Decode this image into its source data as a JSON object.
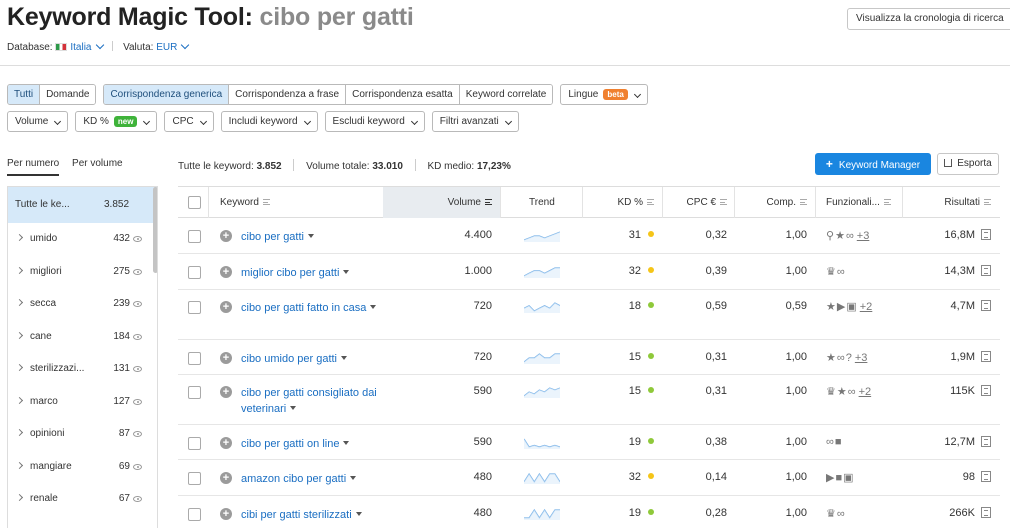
{
  "header": {
    "title": "Keyword Magic Tool:",
    "query": "cibo per gatti",
    "history_button": "Visualizza la cronologia di ricerca",
    "database_label": "Database:",
    "database_value": "Italia",
    "currency_label": "Valuta:",
    "currency_value": "EUR"
  },
  "filters": {
    "scope": [
      "Tutti",
      "Domande"
    ],
    "match": [
      "Corrispondenza generica",
      "Corrispondenza a frase",
      "Corrispondenza esatta",
      "Keyword correlate"
    ],
    "languages": {
      "label": "Lingue",
      "badge": "beta"
    },
    "row2": [
      {
        "label": "Volume"
      },
      {
        "label": "KD %",
        "badge": "new"
      },
      {
        "label": "CPC"
      },
      {
        "label": "Includi keyword"
      },
      {
        "label": "Escludi keyword"
      },
      {
        "label": "Filtri avanzati"
      }
    ],
    "colors": {
      "active": "#d6e9f9",
      "beta": "#f0802f",
      "new": "#3fb33a"
    }
  },
  "tabs": [
    "Per numero",
    "Per volume"
  ],
  "totals": {
    "all_label": "Tutte le keyword:",
    "all_value": "3.852",
    "volume_label": "Volume totale:",
    "volume_value": "33.010",
    "kd_label": "KD medio:",
    "kd_value": "17,23%"
  },
  "actions": {
    "keyword_manager": "Keyword Manager",
    "export": "Esporta"
  },
  "sidebar": {
    "all": {
      "label": "Tutte le ke...",
      "count": "3.852"
    },
    "groups": [
      {
        "label": "umido",
        "count": "432"
      },
      {
        "label": "migliori",
        "count": "275"
      },
      {
        "label": "secca",
        "count": "239"
      },
      {
        "label": "cane",
        "count": "184"
      },
      {
        "label": "sterilizzazi...",
        "count": "131"
      },
      {
        "label": "marco",
        "count": "127"
      },
      {
        "label": "opinioni",
        "count": "87"
      },
      {
        "label": "mangiare",
        "count": "69"
      },
      {
        "label": "renale",
        "count": "67"
      }
    ]
  },
  "table": {
    "columns": [
      "Keyword",
      "Volume",
      "Trend",
      "KD %",
      "CPC €",
      "Comp.",
      "Funzionali...",
      "Risultati"
    ],
    "kd_colors": {
      "medium": "#f5c518",
      "easy": "#8fc93a"
    },
    "rows": [
      {
        "keyword": "cibo per gatti",
        "volume": "4.400",
        "trend": [
          6,
          7,
          8,
          8,
          7,
          8,
          9,
          10
        ],
        "kd": "31",
        "kd_level": "medium",
        "cpc": "0,32",
        "comp": "1,00",
        "features": [
          "pin-icon",
          "star-icon",
          "link-icon"
        ],
        "more": "+3",
        "results": "16,8M"
      },
      {
        "keyword": "miglior cibo per gatti",
        "volume": "1.000",
        "trend": [
          5,
          6,
          7,
          7,
          6,
          7,
          8,
          8
        ],
        "kd": "32",
        "kd_level": "medium",
        "cpc": "0,39",
        "comp": "1,00",
        "features": [
          "crown-icon",
          "link-icon"
        ],
        "more": "",
        "results": "14,3M"
      },
      {
        "keyword": "cibo per gatti fatto in casa",
        "volume": "720",
        "trend": [
          7,
          8,
          6,
          7,
          8,
          7,
          9,
          8
        ],
        "kd": "18",
        "kd_level": "easy",
        "cpc": "0,59",
        "comp": "0,59",
        "features": [
          "star-icon",
          "video-icon",
          "image-icon"
        ],
        "more": "+2",
        "results": "4,7M"
      },
      {
        "keyword": "cibo umido per gatti",
        "volume": "720",
        "trend": [
          6,
          7,
          7,
          8,
          7,
          7,
          8,
          8
        ],
        "kd": "15",
        "kd_level": "easy",
        "cpc": "0,31",
        "comp": "1,00",
        "features": [
          "star-icon",
          "link-icon",
          "question-icon"
        ],
        "more": "+3",
        "results": "1,9M"
      },
      {
        "keyword": "cibo per gatti consigliato dai veterinari",
        "volume": "590",
        "trend": [
          5,
          7,
          6,
          8,
          7,
          9,
          8,
          9
        ],
        "kd": "15",
        "kd_level": "easy",
        "cpc": "0,31",
        "comp": "1,00",
        "features": [
          "crown-icon",
          "star-icon",
          "link-icon"
        ],
        "more": "+2",
        "results": "115K"
      },
      {
        "keyword": "cibo per gatti on line",
        "volume": "590",
        "trend": [
          8,
          3,
          4,
          3,
          4,
          3,
          4,
          3
        ],
        "kd": "19",
        "kd_level": "easy",
        "cpc": "0,38",
        "comp": "1,00",
        "features": [
          "link-icon",
          "review-icon"
        ],
        "more": "",
        "results": "12,7M"
      },
      {
        "keyword": "amazon cibo per gatti",
        "volume": "480",
        "trend": [
          5,
          6,
          5,
          6,
          5,
          6,
          6,
          5
        ],
        "kd": "32",
        "kd_level": "medium",
        "cpc": "0,14",
        "comp": "1,00",
        "features": [
          "video-icon",
          "review-icon",
          "image-icon"
        ],
        "more": "",
        "results": "98"
      },
      {
        "keyword": "cibi per gatti sterilizzati",
        "volume": "480",
        "trend": [
          6,
          6,
          7,
          6,
          7,
          6,
          7,
          7
        ],
        "kd": "19",
        "kd_level": "easy",
        "cpc": "0,28",
        "comp": "1,00",
        "features": [
          "crown-icon",
          "link-icon"
        ],
        "more": "",
        "results": "266K"
      }
    ]
  }
}
